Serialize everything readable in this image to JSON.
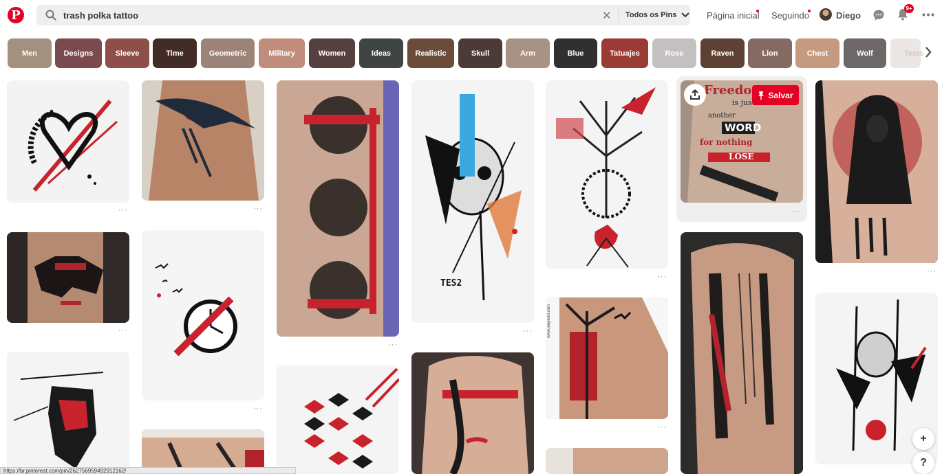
{
  "header": {
    "logo": "P",
    "search_value": "trash polka tattoo",
    "scope_label": "Todos os Pins",
    "nav_home": "Página inicial",
    "nav_following": "Seguindo",
    "user_name": "Diego",
    "notifications_badge": "9+"
  },
  "chips": [
    {
      "label": "Men",
      "color": "#a4907f"
    },
    {
      "label": "Designs",
      "color": "#7b4a4e"
    },
    {
      "label": "Sleeve",
      "color": "#8e4f4a"
    },
    {
      "label": "Time",
      "color": "#432c27"
    },
    {
      "label": "Geometric",
      "color": "#9b8377"
    },
    {
      "label": "Military",
      "color": "#c08c7c"
    },
    {
      "label": "Women",
      "color": "#56403f"
    },
    {
      "label": "Ideas",
      "color": "#3e4542"
    },
    {
      "label": "Realistic",
      "color": "#6b4c3a"
    },
    {
      "label": "Skull",
      "color": "#4c3a36"
    },
    {
      "label": "Arm",
      "color": "#a89284"
    },
    {
      "label": "Blue",
      "color": "#303030"
    },
    {
      "label": "Tatuajes",
      "color": "#9b3b35"
    },
    {
      "label": "Rose",
      "color": "#c4c0bf"
    },
    {
      "label": "Raven",
      "color": "#5e4132"
    },
    {
      "label": "Lion",
      "color": "#846a62"
    },
    {
      "label": "Chest",
      "color": "#c59a7e"
    },
    {
      "label": "Wolf",
      "color": "#6e6768"
    },
    {
      "label": "Texts",
      "color": "#ece7e4"
    }
  ],
  "pin_actions": {
    "save_label": "Salvar",
    "more_label": "···"
  },
  "tattoo_text": {
    "signature": "TES2",
    "freedom": "Freedom",
    "is_just": "is just",
    "another": "another",
    "word": "WORD",
    "nothing": "for nothing",
    "lose": "LOSE",
    "url": "www.jenpeart.com"
  },
  "fab": {
    "plus": "+",
    "help": "?"
  },
  "status_bar": "https://br.pinterest.com/pin/262756959492912162/"
}
